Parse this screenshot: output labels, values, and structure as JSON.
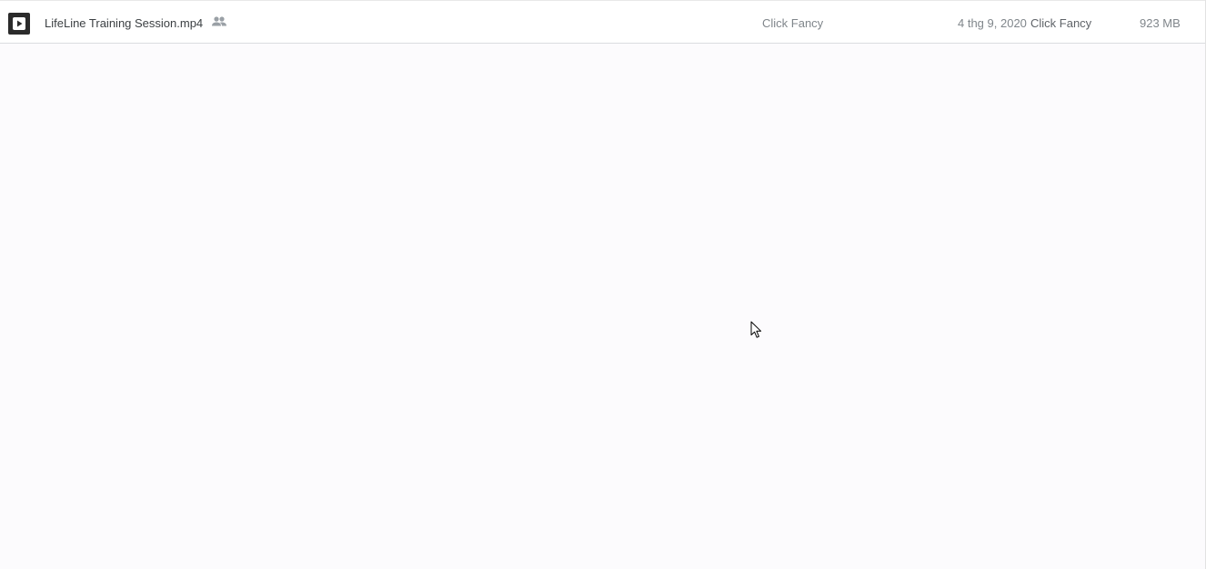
{
  "file_list": {
    "rows": [
      {
        "name": "LifeLine Training Session.mp4",
        "thumbnail_icon": "video-play-icon",
        "shared_icon": "people-icon",
        "owner": "Click Fancy",
        "modified_date": "4 thg 9, 2020",
        "modified_by": "Click Fancy",
        "size": "923 MB"
      }
    ]
  },
  "colors": {
    "background": "#fcfbfd",
    "row_background": "#ffffff",
    "primary_text": "#3c4043",
    "secondary_text": "#80868b",
    "icon_gray": "#9aa0a6"
  }
}
